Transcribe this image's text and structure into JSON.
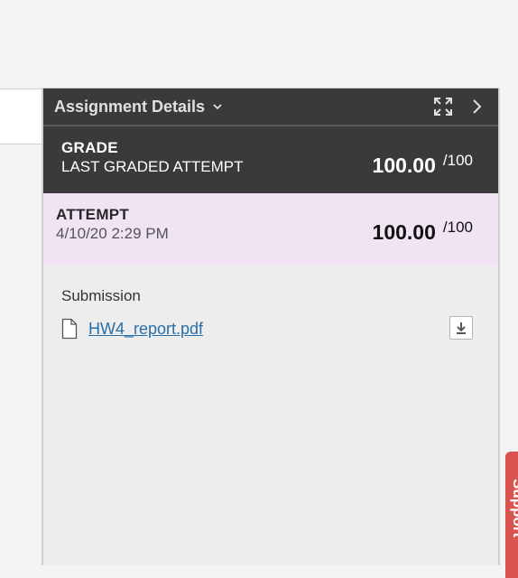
{
  "panel": {
    "title": "Assignment Details"
  },
  "grade": {
    "label": "GRADE",
    "sublabel": "LAST GRADED ATTEMPT",
    "score": "100.00",
    "max": "/100"
  },
  "attempt": {
    "label": "ATTEMPT",
    "date": "4/10/20 2:29 PM",
    "score": "100.00",
    "max": "/100"
  },
  "submission": {
    "label": "Submission",
    "file_name": "HW4_report.pdf"
  },
  "support_tab": {
    "label": "Support"
  },
  "icons": {
    "title_dropdown": "chevron-down-icon",
    "expand": "expand-icon",
    "collapse_panel": "chevron-right-icon",
    "file": "file-icon",
    "download": "download-icon"
  },
  "colors": {
    "header_bg": "#3a3a3a",
    "attempt_bg": "#f0e3f4",
    "link": "#2a6ea6",
    "support_tab": "#d9534f"
  }
}
